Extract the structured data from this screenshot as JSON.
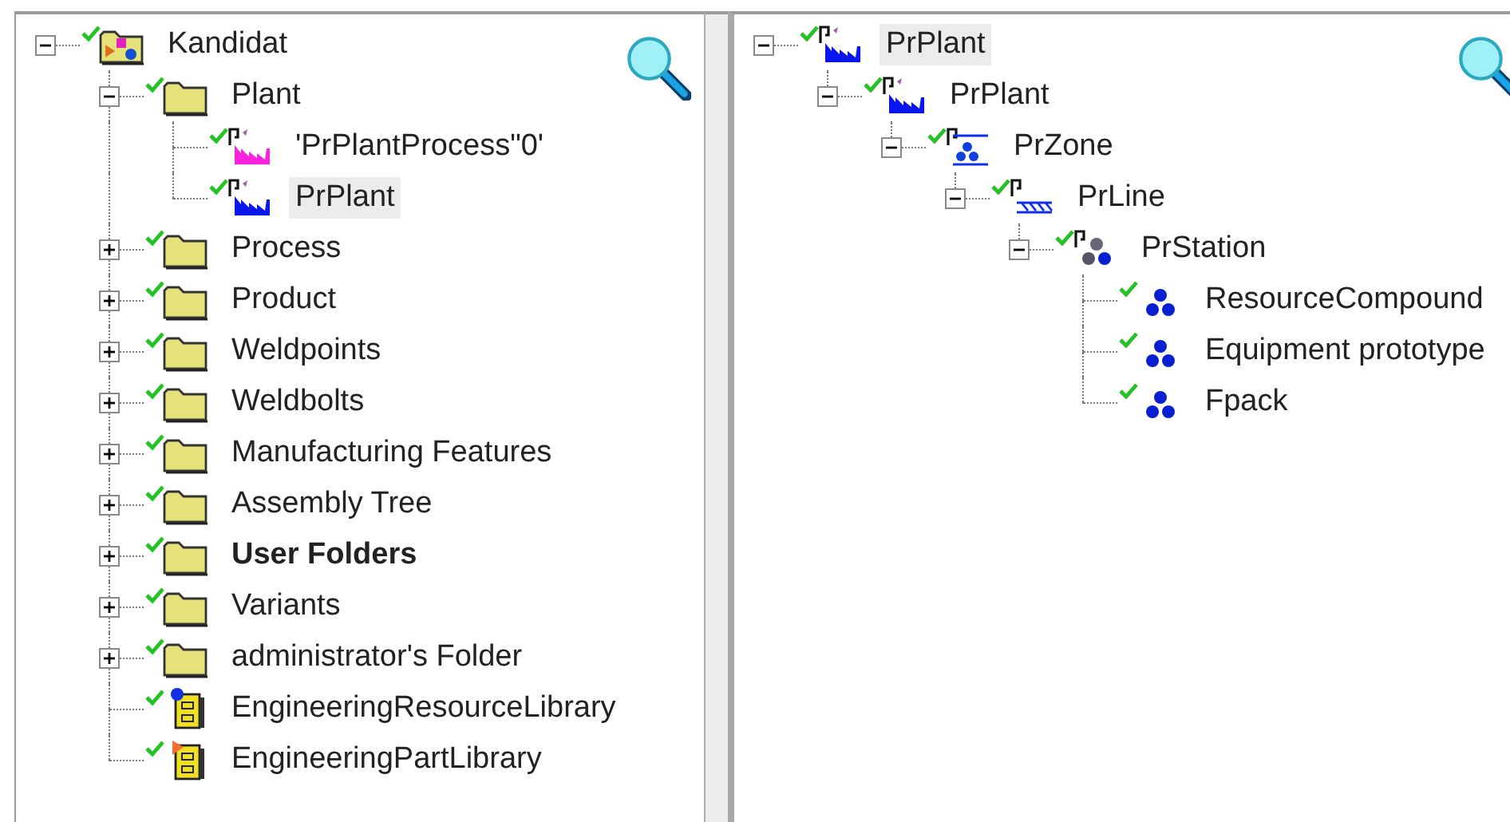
{
  "left_tree": {
    "nodes": [
      {
        "label": "Kandidat",
        "kind": "project",
        "expanded": true,
        "selected": false,
        "children": [
          {
            "label": "Plant",
            "kind": "folder",
            "expanded": true,
            "selected": false,
            "children": [
              {
                "label": "'PrPlantProcess\"0'",
                "kind": "process",
                "selected": false
              },
              {
                "label": "PrPlant",
                "kind": "plant",
                "selected": true
              }
            ]
          },
          {
            "label": "Process",
            "kind": "folder",
            "expanded": false,
            "selected": false
          },
          {
            "label": "Product",
            "kind": "folder",
            "expanded": false,
            "selected": false
          },
          {
            "label": "Weldpoints",
            "kind": "folder",
            "expanded": false,
            "selected": false
          },
          {
            "label": "Weldbolts",
            "kind": "folder",
            "expanded": false,
            "selected": false
          },
          {
            "label": "Manufacturing Features",
            "kind": "folder",
            "expanded": false,
            "selected": false
          },
          {
            "label": "Assembly Tree",
            "kind": "folder",
            "expanded": false,
            "selected": false
          },
          {
            "label": "User Folders",
            "kind": "folder",
            "expanded": false,
            "selected": false,
            "bold": true
          },
          {
            "label": "Variants",
            "kind": "folder",
            "expanded": false,
            "selected": false
          },
          {
            "label": "administrator's Folder",
            "kind": "folder",
            "expanded": false,
            "selected": false
          },
          {
            "label": "EngineeringResourceLibrary",
            "kind": "resource_library",
            "selected": false
          },
          {
            "label": "EngineeringPartLibrary",
            "kind": "part_library",
            "selected": false
          }
        ]
      }
    ]
  },
  "right_tree": {
    "nodes": [
      {
        "label": "PrPlant",
        "kind": "plant",
        "expanded": true,
        "selected": true,
        "children": [
          {
            "label": "PrPlant",
            "kind": "plant",
            "expanded": true,
            "selected": false,
            "children": [
              {
                "label": "PrZone",
                "kind": "zone",
                "expanded": true,
                "selected": false,
                "children": [
                  {
                    "label": "PrLine",
                    "kind": "line",
                    "expanded": true,
                    "selected": false,
                    "children": [
                      {
                        "label": "PrStation",
                        "kind": "station",
                        "expanded": true,
                        "selected": false,
                        "children": [
                          {
                            "label": "ResourceCompound",
                            "kind": "resource",
                            "selected": false
                          },
                          {
                            "label": "Equipment prototype",
                            "kind": "resource",
                            "selected": false
                          },
                          {
                            "label": "Fpack",
                            "kind": "resource",
                            "selected": false
                          }
                        ]
                      }
                    ]
                  }
                ]
              }
            ]
          }
        ]
      }
    ]
  }
}
